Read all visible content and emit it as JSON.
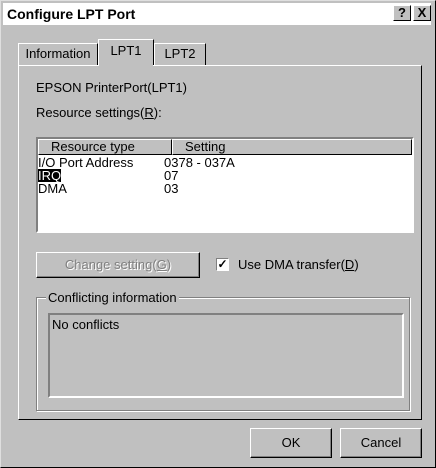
{
  "window": {
    "title": "Configure LPT Port",
    "help_glyph": "?",
    "close_glyph": "X"
  },
  "tabs": [
    {
      "label": "Information"
    },
    {
      "label": "LPT1"
    },
    {
      "label": "LPT2"
    }
  ],
  "device_name": "EPSON PrinterPort(LPT1)",
  "resource_label": {
    "text": "Resource settings(",
    "accel": "R",
    "end": "):"
  },
  "list": {
    "headers": [
      "Resource type",
      "Setting"
    ],
    "rows": [
      {
        "type": "I/O Port Address",
        "setting": "0378 - 037A"
      },
      {
        "type": "IRQ",
        "setting": "07"
      },
      {
        "type": "DMA",
        "setting": "03"
      }
    ]
  },
  "change_setting": {
    "text": "Change setting(",
    "accel": "G",
    "end": ")"
  },
  "dma_transfer": {
    "text": "Use DMA transfer(",
    "accel": "D",
    "end": ")",
    "checked_glyph": "✓"
  },
  "conflicts": {
    "legend": "Conflicting information",
    "text": "No conflicts"
  },
  "buttons": {
    "ok": "OK",
    "cancel": "Cancel"
  }
}
